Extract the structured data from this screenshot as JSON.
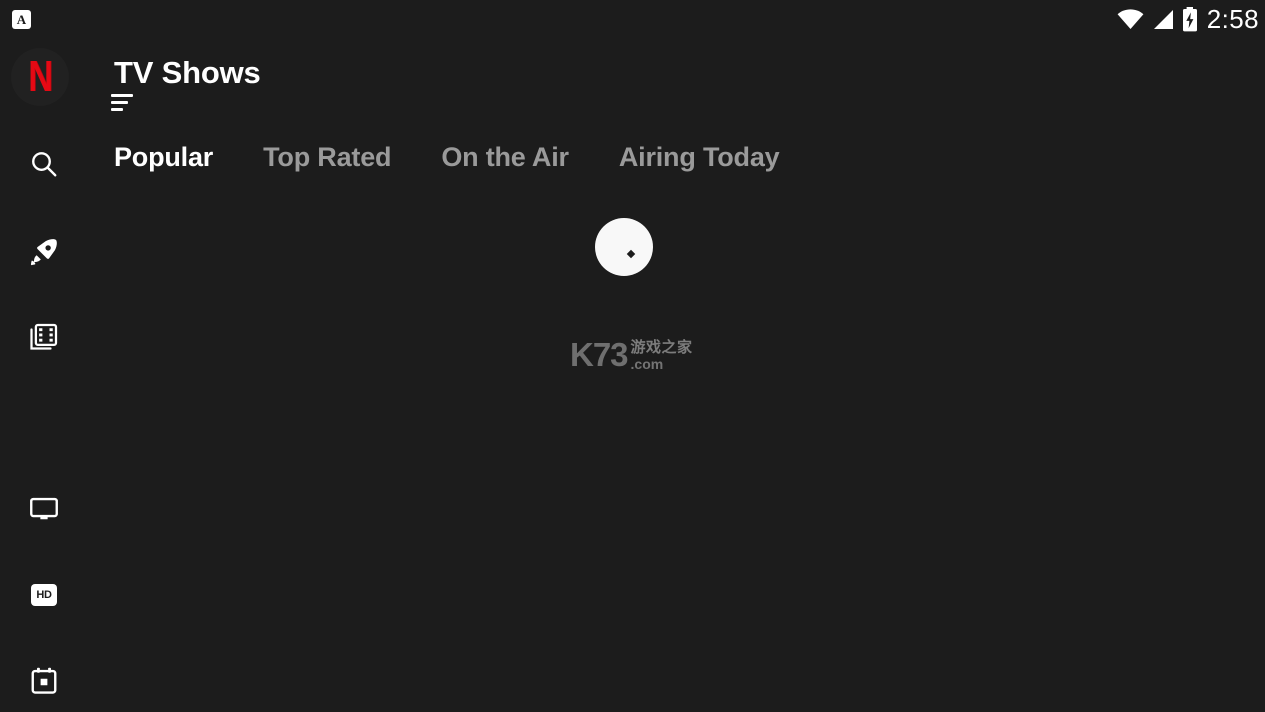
{
  "statusbar": {
    "notification_icon": "app-letter-a-icon",
    "notification_letter": "A",
    "wifi_icon": "wifi-full-icon",
    "signal_icon": "cellular-signal-icon",
    "battery_icon": "battery-charging-icon",
    "clock": "2:58"
  },
  "sidebar": {
    "brand": {
      "name": "netflix-logo",
      "glyph": "N",
      "color": "#e50914"
    },
    "items": [
      {
        "name": "sidebar-item-search",
        "icon": "search-icon",
        "label": "Search"
      },
      {
        "name": "sidebar-item-discover",
        "icon": "rocket-icon",
        "label": "Discover"
      },
      {
        "name": "sidebar-item-movies",
        "icon": "film-icon",
        "label": "Movies"
      },
      {
        "name": "sidebar-item-tv",
        "icon": "monitor-icon",
        "label": "TV"
      },
      {
        "name": "sidebar-item-hd",
        "icon": "hd-badge-icon",
        "label": "HD"
      },
      {
        "name": "sidebar-item-calendar",
        "icon": "calendar-icon",
        "label": "Calendar"
      }
    ]
  },
  "header": {
    "title": "TV Shows",
    "menu_icon": "hamburger-menu-icon"
  },
  "tabs": [
    {
      "label": "Popular",
      "active": true
    },
    {
      "label": "Top Rated",
      "active": false
    },
    {
      "label": "On the Air",
      "active": false
    },
    {
      "label": "Airing Today",
      "active": false
    }
  ],
  "main": {
    "loading": {
      "name": "loading-spinner",
      "visible": true
    }
  },
  "watermark": {
    "primary": "K73",
    "secondary": "游戏之家",
    "tertiary": ".com"
  },
  "colors": {
    "background": "#1c1c1c",
    "text_primary": "#ffffff",
    "text_muted": "#9a9a9a",
    "brand_red": "#e50914"
  }
}
